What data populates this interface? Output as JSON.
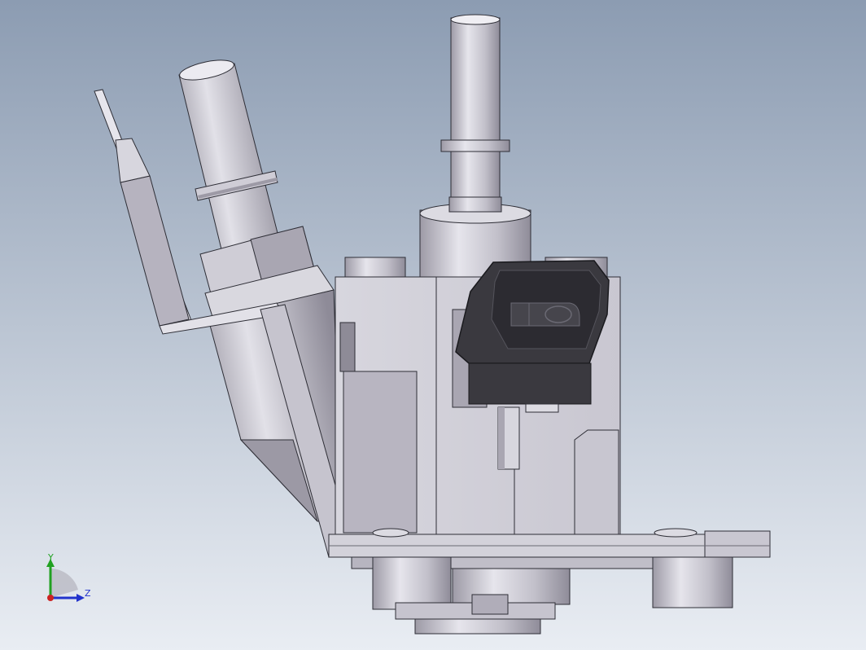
{
  "viewport": {
    "colors": {
      "background_top": "#8c9cb2",
      "background_bottom": "#e9edf3",
      "part_light": "#d4d3db",
      "part_mid": "#b7b5c0",
      "part_dark": "#8e8b97",
      "edge": "#2e2e36",
      "connector": "#3a393f"
    }
  },
  "triad": {
    "y_label": "Y",
    "z_label": "Z",
    "y_color": "#21a121",
    "z_color": "#2233cc",
    "origin_color": "#cc2222"
  }
}
